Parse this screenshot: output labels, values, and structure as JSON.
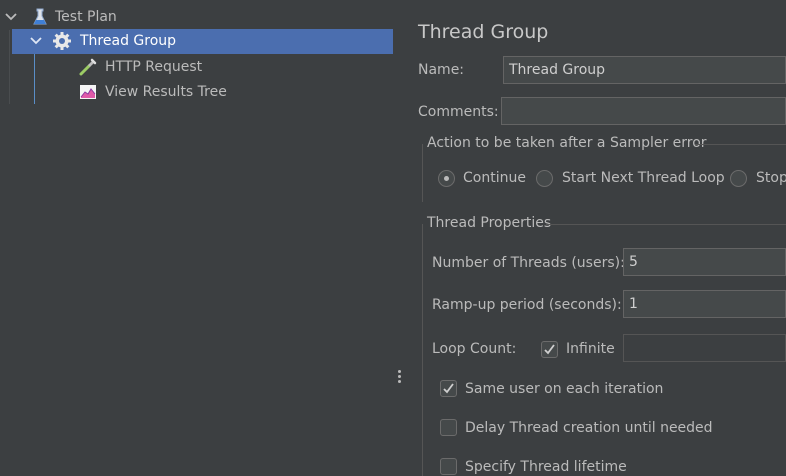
{
  "tree": {
    "items": [
      {
        "label": "Test Plan",
        "icon": "test-plan-icon"
      },
      {
        "label": "Thread Group",
        "icon": "gear-icon"
      },
      {
        "label": "HTTP Request",
        "icon": "pipette-icon"
      },
      {
        "label": "View Results Tree",
        "icon": "chart-icon"
      }
    ]
  },
  "editor": {
    "title": "Thread Group",
    "name_label": "Name:",
    "name_value": "Thread Group",
    "comments_label": "Comments:",
    "comments_value": "",
    "sampler_error_section": "Action to be taken after a Sampler error",
    "sampler_error_options": [
      {
        "label": "Continue",
        "selected": true
      },
      {
        "label": "Start Next Thread Loop",
        "selected": false
      },
      {
        "label": "Stop",
        "selected": false
      }
    ],
    "thread_props_section": "Thread Properties",
    "threads_label": "Number of Threads (users):",
    "threads_value": "5",
    "rampup_label": "Ramp-up period (seconds):",
    "rampup_value": "1",
    "loop_label": "Loop Count:",
    "infinite_label": "Infinite",
    "infinite_checked": true,
    "loop_value": "",
    "same_user_label": "Same user on each iteration",
    "same_user_checked": true,
    "delay_label": "Delay Thread creation until needed",
    "delay_checked": false,
    "lifetime_label": "Specify Thread lifetime",
    "lifetime_checked": false
  },
  "colors": {
    "background": "#3c3f41",
    "selection": "#4b6eaf",
    "text": "#bbbbbb"
  }
}
